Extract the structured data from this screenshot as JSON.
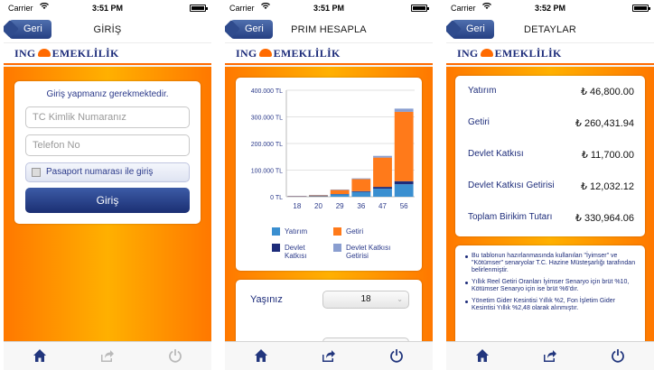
{
  "status": {
    "carrier": "Carrier",
    "screens_time": [
      "3:51 PM",
      "3:51 PM",
      "3:52 PM"
    ]
  },
  "nav": {
    "back_label": "Geri",
    "screen1_title": "GİRİŞ",
    "screen2_title": "PRIM HESAPLA",
    "screen3_title": "DETAYLAR"
  },
  "brand": {
    "left": "ING",
    "right": "EMEKLİLİK",
    "colors": {
      "orange": "#ff7800",
      "navy": "#1d2c7a"
    }
  },
  "login": {
    "info": "Giriş yapmanız gerekmektedir.",
    "tc_placeholder": "TC Kimlik Numaranız",
    "phone_placeholder": "Telefon No",
    "passport_label": "Pasaport numarası ile giriş",
    "submit_label": "Giriş"
  },
  "chart_data": {
    "type": "bar",
    "stacked": true,
    "categories": [
      "18",
      "20",
      "29",
      "36",
      "47",
      "56"
    ],
    "yticks": [
      "400.000 TL",
      "300.000 TL",
      "200.000 TL",
      "100.000 TL",
      "0 TL"
    ],
    "ylim": [
      0,
      400000
    ],
    "grid": true,
    "legend_position": "bottom",
    "series": [
      {
        "name": "Yatırım",
        "color": "#3a8fd0",
        "values": [
          500,
          2000,
          9000,
          18000,
          30000,
          46800
        ]
      },
      {
        "name": "Devlet Katkısı",
        "color": "#1d2c7a",
        "values": [
          100,
          300,
          1200,
          3000,
          7000,
          11700
        ]
      },
      {
        "name": "Getiri",
        "color": "#ff7a1a",
        "values": [
          300,
          2500,
          15000,
          45000,
          110000,
          260431.94
        ]
      },
      {
        "name": "Devlet Katkısı Getirisi",
        "color": "#8a9ed0",
        "values": [
          50,
          200,
          1200,
          3000,
          6500,
          12032.12
        ]
      }
    ]
  },
  "legend": [
    {
      "label": "Yatırım",
      "color": "#3a8fd0"
    },
    {
      "label": "Getiri",
      "color": "#ff7a1a"
    },
    {
      "label": "Devlet Katkısı",
      "color": "#1d2c7a"
    },
    {
      "label": "Devlet Katkısı Getirisi",
      "color": "#8a9ed0"
    }
  ],
  "form": {
    "age_label": "Yaşınız",
    "age_value": "18"
  },
  "details": {
    "rows": [
      {
        "label": "Yatırım",
        "value": "₺ 46,800.00"
      },
      {
        "label": "Getiri",
        "value": "₺ 260,431.94"
      },
      {
        "label": "Devlet Katkısı",
        "value": "₺ 11,700.00"
      },
      {
        "label": "Devlet Katkısı Getirisi",
        "value": "₺ 12,032.12"
      },
      {
        "label": "Toplam Birikim Tutarı",
        "value": "₺ 330,964.06"
      }
    ],
    "notes": [
      "Bu tablonun hazırlanmasında kullanılan \"İyimser\" ve \"Kötümser\" senaryolar T.C. Hazine Müsteşarlığı tarafından belirlenmiştir.",
      "Yıllık Reel Getiri Oranları İyimser Senaryo için brüt %10, Kötümser Senaryo için ise brüt %6'dır.",
      "Yönetim Gider Kesintisi Yıllık %2, Fon İşletim Gider Kesintisi Yıllık %2,48 olarak alınmıştır."
    ]
  },
  "tabbar": {
    "icons": [
      "home-icon",
      "share-icon",
      "power-icon"
    ]
  }
}
